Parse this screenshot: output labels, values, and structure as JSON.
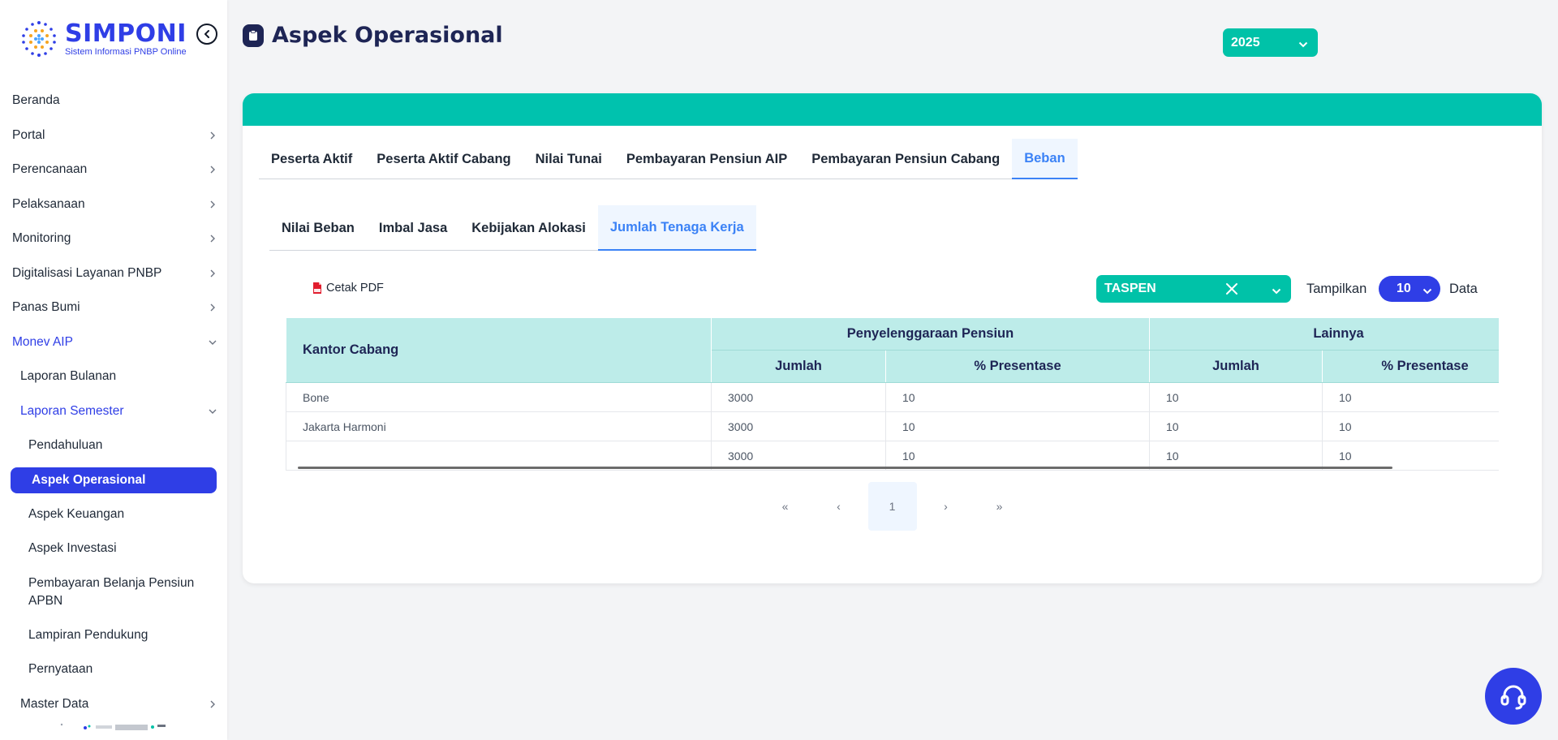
{
  "app": {
    "logo_title": "SIMPONI",
    "logo_subtitle": "Sistem Informasi PNBP Online"
  },
  "sidebar": {
    "items": [
      {
        "label": "Beranda"
      },
      {
        "label": "Portal"
      },
      {
        "label": "Perencanaan"
      },
      {
        "label": "Pelaksanaan"
      },
      {
        "label": "Monitoring"
      },
      {
        "label": "Digitalisasi Layanan PNBP"
      },
      {
        "label": "Panas Bumi"
      },
      {
        "label": "Monev AIP"
      },
      {
        "label": "Laporan Bulanan"
      },
      {
        "label": "Laporan Semester"
      },
      {
        "label": "Pendahuluan"
      },
      {
        "label": "Aspek Operasional"
      },
      {
        "label": "Aspek Keuangan"
      },
      {
        "label": "Aspek Investasi"
      },
      {
        "label": "Pembayaran Belanja Pensiun APBN"
      },
      {
        "label": "Lampiran Pendukung"
      },
      {
        "label": "Pernyataan"
      },
      {
        "label": "Master Data"
      }
    ]
  },
  "header": {
    "title": "Aspek Operasional",
    "year": "2025"
  },
  "tabs": [
    {
      "label": "Peserta Aktif"
    },
    {
      "label": "Peserta Aktif Cabang"
    },
    {
      "label": "Nilai Tunai"
    },
    {
      "label": "Pembayaran Pensiun AIP"
    },
    {
      "label": "Pembayaran Pensiun Cabang"
    },
    {
      "label": "Beban"
    }
  ],
  "subtabs": [
    {
      "label": "Nilai Beban"
    },
    {
      "label": "Imbal Jasa"
    },
    {
      "label": "Kebijakan Alokasi"
    },
    {
      "label": "Jumlah Tenaga Kerja"
    }
  ],
  "toolbar": {
    "pdf_label": "Cetak PDF",
    "org_value": "TASPEN",
    "show_label": "Tampilkan",
    "show_value": "10",
    "data_label": "Data"
  },
  "table": {
    "col_kantor": "Kantor Cabang",
    "group1": "Penyelenggaraan Pensiun",
    "group2": "Lainnya",
    "sub_jumlah": "Jumlah",
    "sub_presentase": "% Presentase",
    "rows": [
      {
        "kantor": "Bone",
        "j1": "3000",
        "p1": "10",
        "j2": "10",
        "p2": "10"
      },
      {
        "kantor": "Jakarta Harmoni",
        "j1": "3000",
        "p1": "10",
        "j2": "10",
        "p2": "10"
      },
      {
        "kantor": "",
        "j1": "3000",
        "p1": "10",
        "j2": "10",
        "p2": "10"
      }
    ]
  },
  "pagination": {
    "first": "«",
    "prev": "‹",
    "current": "1",
    "next": "›",
    "last": "»"
  },
  "colors": {
    "brand_blue": "#2f3ee6",
    "teal": "#00c2a8",
    "header_teal_light": "#bdece9",
    "tab_active": "#3b82f6"
  },
  "icons": [
    "collapse-left-icon",
    "clipboard-icon",
    "chevron-down-icon",
    "chevron-right-icon",
    "pdf-file-icon",
    "clear-icon",
    "headset-icon"
  ]
}
